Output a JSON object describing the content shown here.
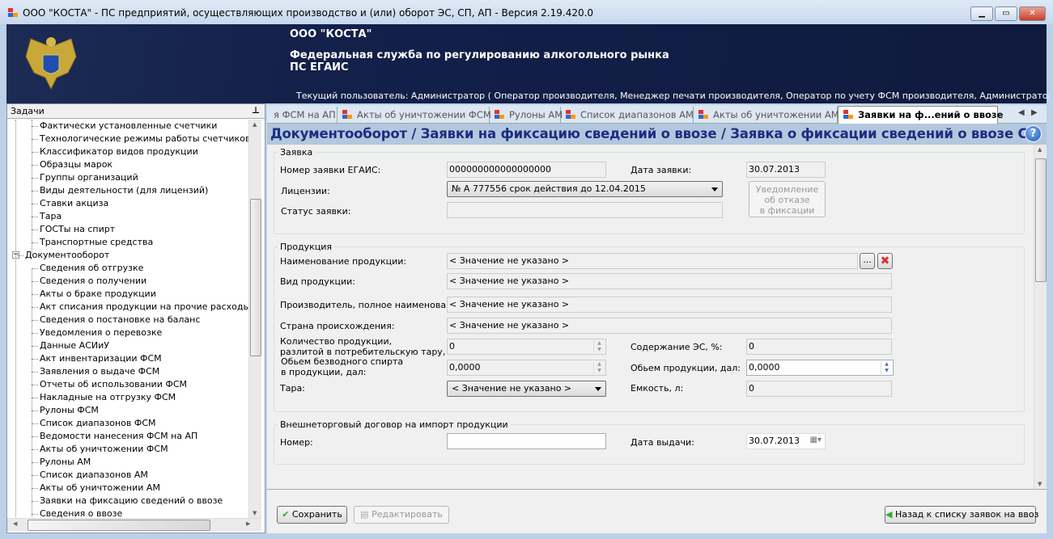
{
  "window": {
    "title": "ООО \"КОСТА\" - ПС предприятий, осуществляющих производство и (или) оборот ЭС, СП, АП - Версия 2.19.420.0",
    "controls": [
      "minimize",
      "maximize",
      "close"
    ]
  },
  "banner": {
    "org": "ООО \"КОСТА\"",
    "service": "Федеральная служба по регулированию алкогольного рынка",
    "system": "ПС ЕГАИС",
    "user": "Текущий пользователь: Администратор ( Оператор производителя, Менеджер печати производителя, Оператор по учету ФСМ производителя, Администратор производителя, Оп..."
  },
  "sidebar": {
    "title": "Задачи",
    "pin_icon": "pin-icon",
    "items": [
      {
        "label": "Фактически установленные счетчики",
        "level": 2
      },
      {
        "label": "Технологические режимы работы счетчиков",
        "level": 2
      },
      {
        "label": "Классификатор видов продукции",
        "level": 2
      },
      {
        "label": "Образцы марок",
        "level": 2
      },
      {
        "label": "Группы организаций",
        "level": 2
      },
      {
        "label": "Виды деятельности (для лицензий)",
        "level": 2
      },
      {
        "label": "Ставки акциза",
        "level": 2
      },
      {
        "label": "Тара",
        "level": 2
      },
      {
        "label": "ГОСТы на спирт",
        "level": 2
      },
      {
        "label": "Транспортные средства",
        "level": 2
      },
      {
        "label": "Документооборот",
        "level": 1,
        "expanded": true
      },
      {
        "label": "Сведения об отгрузке",
        "level": 2
      },
      {
        "label": "Сведения о получении",
        "level": 2
      },
      {
        "label": "Акты о браке продукции",
        "level": 2
      },
      {
        "label": "Акт списания продукции на прочие расходы",
        "level": 2
      },
      {
        "label": "Сведения о постановке на баланс",
        "level": 2
      },
      {
        "label": "Уведомления о перевозке",
        "level": 2
      },
      {
        "label": "Данные АСИиУ",
        "level": 2
      },
      {
        "label": "Акт инвентаризации ФСМ",
        "level": 2
      },
      {
        "label": "Заявления о выдаче ФСМ",
        "level": 2
      },
      {
        "label": "Отчеты об использовании ФСМ",
        "level": 2
      },
      {
        "label": "Накладные на отгрузку ФСМ",
        "level": 2
      },
      {
        "label": "Рулоны ФСМ",
        "level": 2
      },
      {
        "label": "Список диапазонов ФСМ",
        "level": 2
      },
      {
        "label": "Ведомости нанесения ФСМ на АП",
        "level": 2
      },
      {
        "label": "Акты об уничтожении ФСМ",
        "level": 2
      },
      {
        "label": "Рулоны АМ",
        "level": 2
      },
      {
        "label": "Список диапазонов АМ",
        "level": 2
      },
      {
        "label": "Акты об уничтожении АМ",
        "level": 2
      },
      {
        "label": "Заявки на фиксацию сведений о ввозе",
        "level": 2
      },
      {
        "label": "Сведения о ввозе",
        "level": 2
      }
    ]
  },
  "tabs": [
    {
      "label": "я ФСМ на АП",
      "icon": false
    },
    {
      "label": "Акты об уничтожении ФСМ",
      "icon": true
    },
    {
      "label": "Рулоны АМ",
      "icon": true
    },
    {
      "label": "Список диапазонов АМ",
      "icon": true
    },
    {
      "label": "Акты об уничтожении АМ",
      "icon": true
    },
    {
      "label": "Заявки на ф...ений о ввозе",
      "icon": true,
      "active": true
    }
  ],
  "page_title": "Документооборот / Заявки на фиксацию сведений о ввозе / Заявка о фиксации сведений о ввозе СП",
  "help_label": "?",
  "request": {
    "group": "Заявка",
    "number_label": "Номер заявки ЕГАИС:",
    "number_value": "000000000000000000",
    "date_label": "Дата заявки:",
    "date_value": "30.07.2013",
    "license_label": "Лицензии:",
    "license_value": "№ А 777556 срок действия до 12.04.2015",
    "status_label": "Статус заявки:",
    "status_value": "",
    "notice_button": [
      "Уведомление",
      "об отказе",
      "в фиксации"
    ]
  },
  "product": {
    "group": "Продукция",
    "name_label": "Наименование продукции:",
    "name_value": "< Значение не указано >",
    "browse_label": "...",
    "kind_label": "Вид продукции:",
    "kind_value": "< Значение не указано >",
    "producer_label": "Производитель, полное наименование:",
    "producer_value": "< Значение не указано >",
    "country_label": "Страна происхождения:",
    "country_value": "< Значение не указано >",
    "qty_label": [
      "Количество продукции,",
      "разлитой в потребительскую тару, шт:"
    ],
    "qty_value": "0",
    "alcohol_label": "Содержание ЭС, %:",
    "alcohol_value": "0",
    "spirit_label": [
      "Обьем безводного спирта",
      "в продукции, дал:"
    ],
    "spirit_value": "0,0000",
    "volume_label": "Обьем продукции, дал:",
    "volume_value": "0,0000",
    "tare_label": "Тара:",
    "tare_value": "< Значение не указано >",
    "capacity_label": "Емкость, л:",
    "capacity_value": "0"
  },
  "contract": {
    "group": "Внешнеторговый договор на импорт продукции",
    "number_label": "Номер:",
    "number_value": "",
    "date_label": "Дата выдачи:",
    "date_value": "30.07.2013"
  },
  "footer": {
    "save": "Сохранить",
    "edit": "Редактировать",
    "back": "Назад к списку заявок на ввоз"
  }
}
